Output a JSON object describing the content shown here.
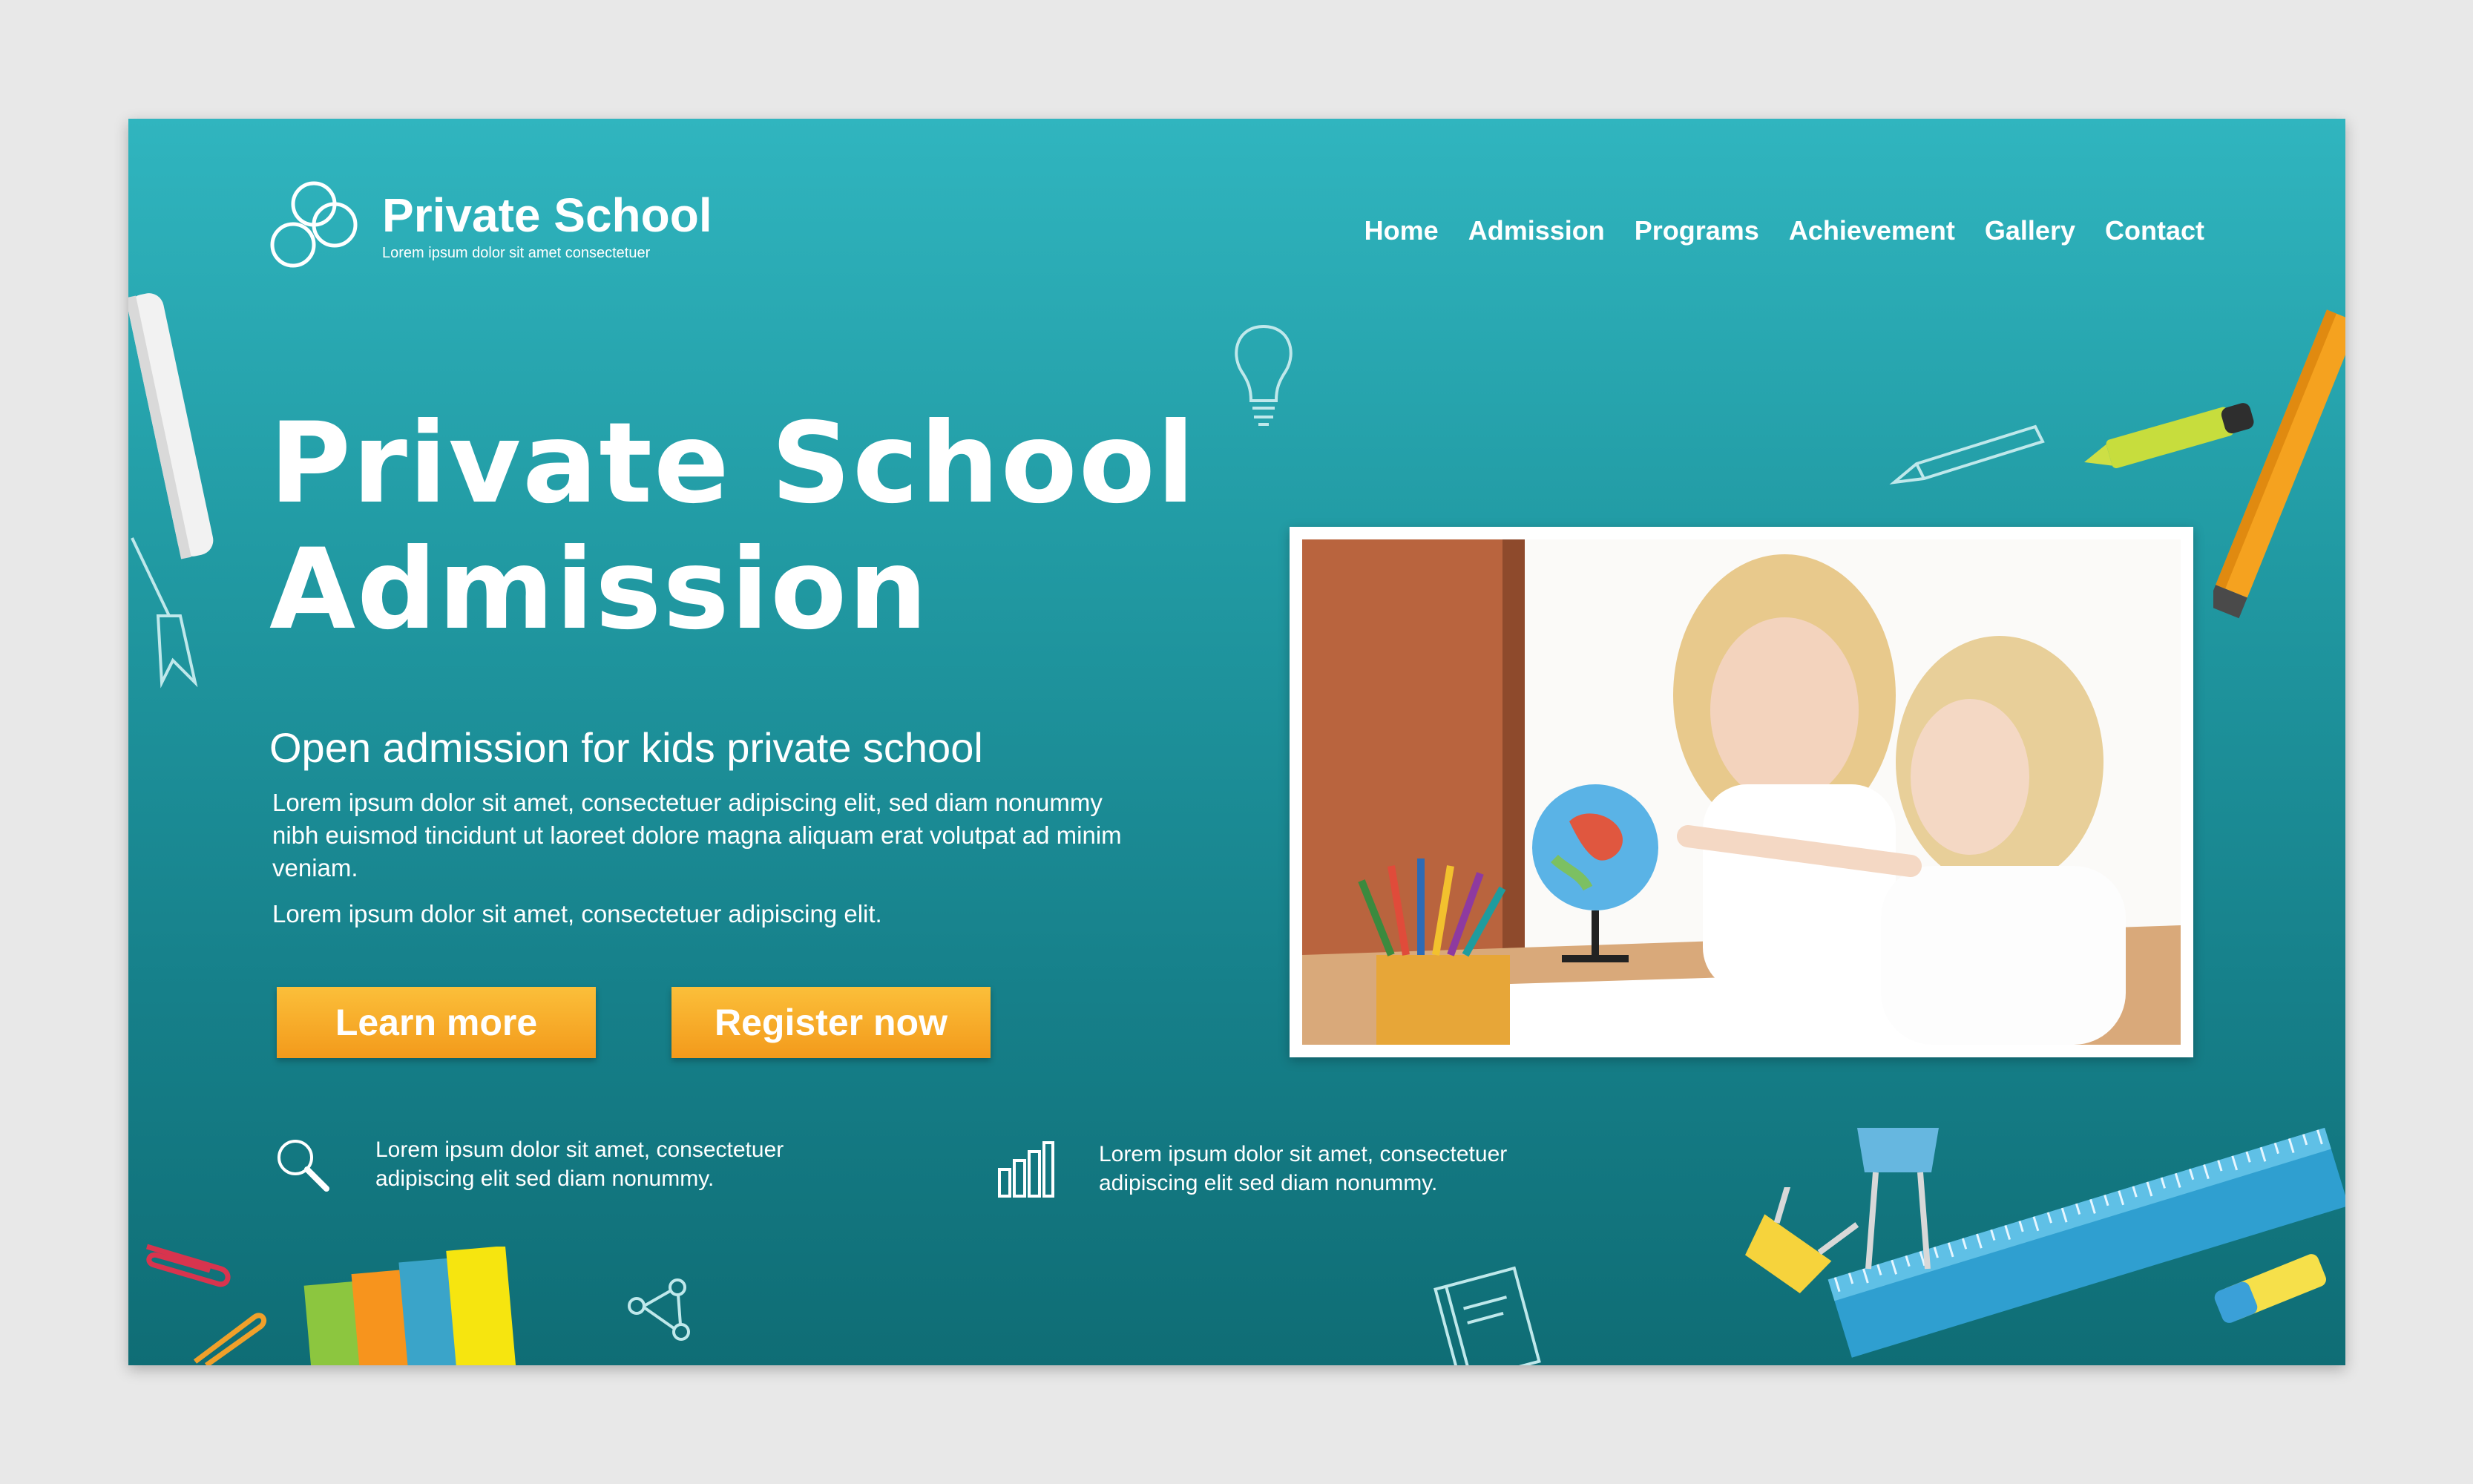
{
  "header": {
    "logo_title": "Private School",
    "logo_subtitle": "Lorem ipsum dolor sit amet consectetuer",
    "nav": [
      "Home",
      "Admission",
      "Programs",
      "Achievement",
      "Gallery",
      "Contact"
    ]
  },
  "hero": {
    "title": "Private School\nAdmission",
    "subtitle": "Open admission for kids private school",
    "body1": "Lorem ipsum dolor sit amet, consectetuer adipiscing elit, sed diam nonummy nibh euismod tincidunt ut laoreet dolore magna aliquam erat volutpat ad minim veniam.",
    "body2": "Lorem ipsum dolor sit amet, consectetuer adipiscing elit."
  },
  "buttons": {
    "learn_more": "Learn more",
    "register_now": "Register now"
  },
  "features": [
    {
      "icon": "search-icon",
      "text": "Lorem ipsum dolor sit amet, consectetuer adipiscing elit sed diam nonummy."
    },
    {
      "icon": "bar-chart-icon",
      "text": "Lorem ipsum dolor sit amet, consectetuer adipiscing elit sed diam nonummy."
    }
  ],
  "colors": {
    "background_top": "#30b5bf",
    "background_bottom": "#0f6d75",
    "button": "#f7a928",
    "text": "#ffffff"
  }
}
